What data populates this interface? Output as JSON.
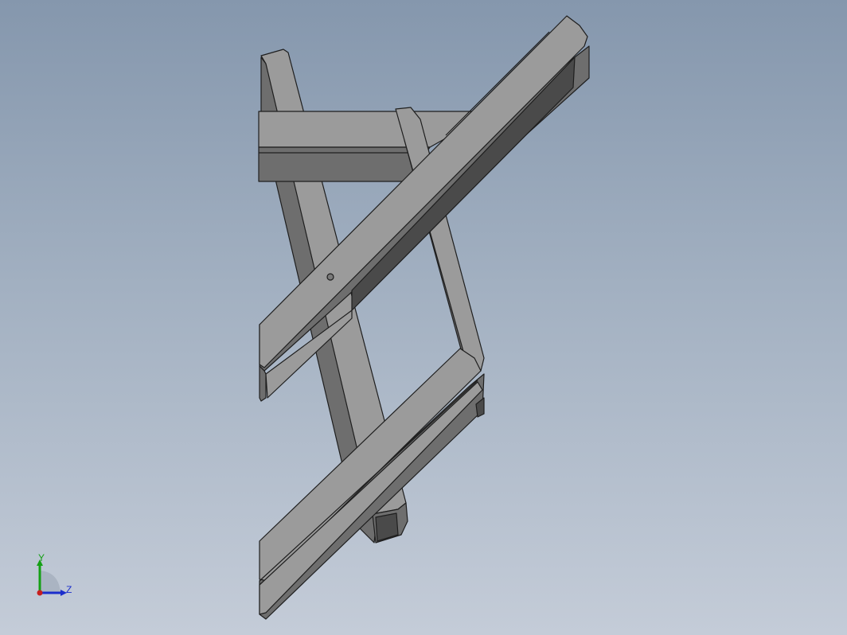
{
  "viewport": {
    "background_top": "#8597ad",
    "background_bottom": "#c4ccd8"
  },
  "model": {
    "part_face_color": "#9b9b9b",
    "part_side_color": "#6e6e6e",
    "part_dark_color": "#4a4a4a",
    "edge_color": "#1e1e1e"
  },
  "triad": {
    "y_label": "Y",
    "z_label": "Z",
    "y_color": "#14a014",
    "z_color": "#1b2ecc",
    "origin_color": "#c81e1e"
  }
}
